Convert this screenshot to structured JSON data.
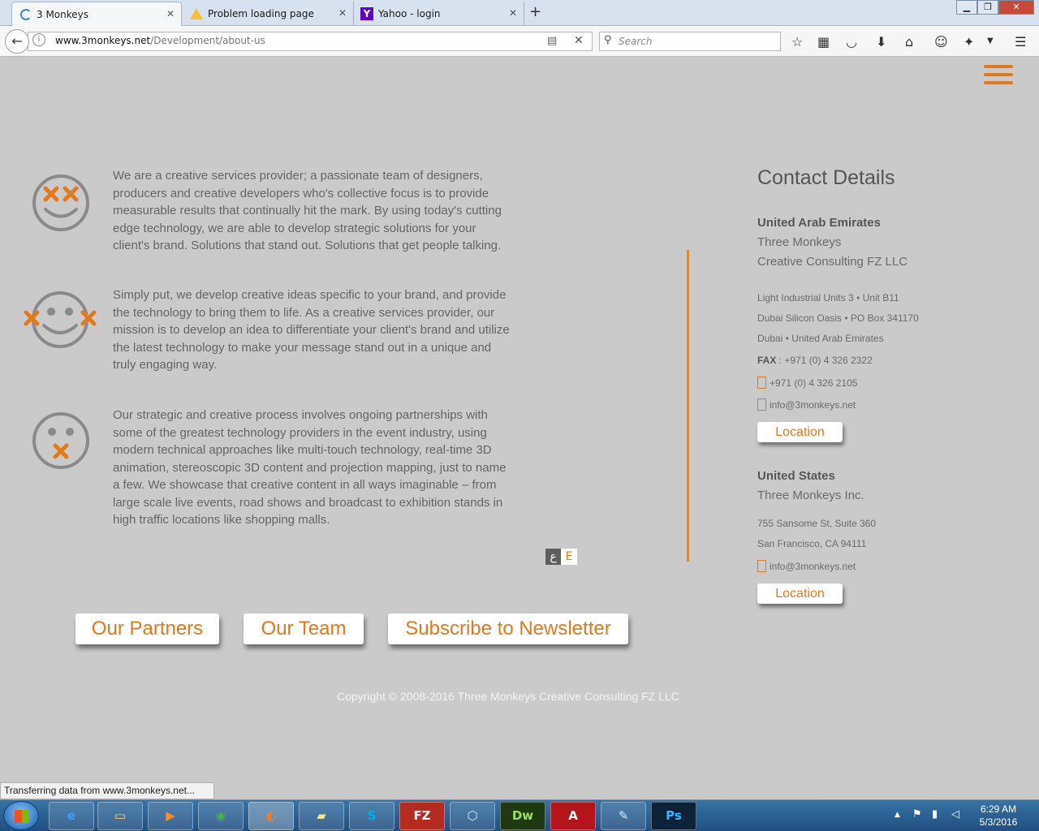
{
  "browser": {
    "tabs": [
      {
        "title": "3 Monkeys"
      },
      {
        "title": "Problem loading page"
      },
      {
        "title": "Yahoo - login"
      }
    ],
    "url_domain": "www.3monkeys.net",
    "url_path": "/Development/about-us",
    "search_placeholder": "Search",
    "status": "Transferring data from www.3monkeys.net..."
  },
  "page": {
    "paragraphs": [
      "We are a creative services provider; a passionate team of designers, producers and creative developers who's collective focus is to provide measurable results that continually hit the mark. By using today's cutting edge technology, we are able to develop strategic solutions for your client's brand. Solutions that stand out. Solutions that get people talking.",
      "Simply put, we develop creative ideas specific to your brand, and provide the technology to bring them to life. As a creative services provider, our mission is to develop an idea to differentiate your client's brand and utilize the latest technology to make your message stand out in a unique and truly engaging way.",
      "Our strategic and creative process involves ongoing partnerships with some of the greatest technology providers in the event industry, using modern technical approaches like multi-touch technology, real-time 3D animation, stereoscopic 3D content and projection mapping, just to name a few. We showcase that creative content in all ways imaginable – from large scale live events, road shows and broadcast to exhibition stands in high traffic locations like shopping malls."
    ],
    "lang": {
      "ar": "ع",
      "en": "E"
    },
    "buttons": {
      "partners": "Our Partners",
      "team": "Our Team",
      "newsletter": "Subscribe to Newsletter"
    },
    "contact": {
      "title": "Contact Details",
      "uae": {
        "country": "United Arab Emirates",
        "company_1": "Three Monkeys",
        "company_2": "Creative Consulting FZ LLC",
        "addr_1": "Light Industrial Units 3 • Unit B11",
        "addr_2": "Dubai Silicon Oasis • PO Box 341170",
        "addr_3": "Dubai • United Arab Emirates",
        "fax_label": "FAX",
        "fax": " : +971 (0) 4 326 2322",
        "phone": "+971 (0) 4 326 2105",
        "email": "info@3monkeys.net",
        "location": "Location"
      },
      "us": {
        "country": "United States",
        "company": "Three Monkeys Inc.",
        "addr_1": "755 Sansome St, Suite 360",
        "addr_2": "San Francisco, CA 94111",
        "email": "info@3monkeys.net",
        "location": "Location"
      }
    },
    "copyright": "Copyright © 2008-2016 Three Monkeys Creative Consulting FZ LLC"
  },
  "taskbar": {
    "time": "6:29 AM",
    "date": "5/3/2016"
  },
  "colors": {
    "accent": "#e07a1c",
    "page_bg": "#cacaca",
    "text": "#656565"
  },
  "icons": [
    "reader-view-icon",
    "bookmark-star-icon",
    "pocket-icon",
    "download-icon",
    "home-icon",
    "hamburger-menu-icon"
  ]
}
